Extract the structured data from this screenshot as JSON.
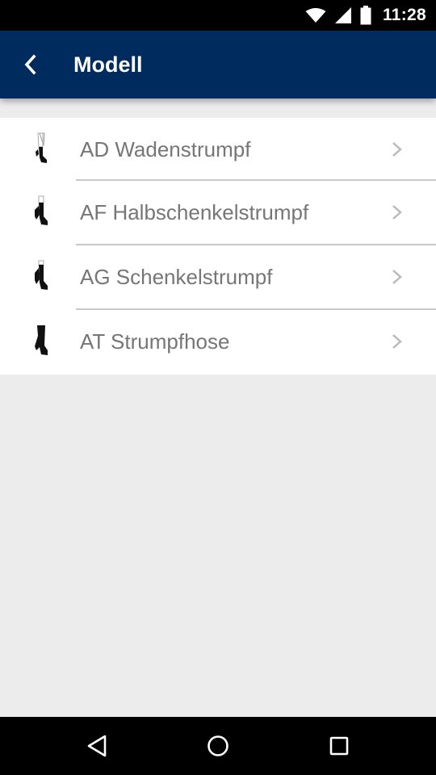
{
  "status_bar": {
    "time": "11:28",
    "icons": [
      "wifi-icon",
      "signal-icon",
      "battery-icon"
    ]
  },
  "app_bar": {
    "title": "Modell",
    "back_icon": "chevron-left-icon",
    "background_color": "#002b5f"
  },
  "list": {
    "items": [
      {
        "label": "AD Wadenstrumpf",
        "icon": "stocking-calf-icon"
      },
      {
        "label": "AF Halbschenkelstrumpf",
        "icon": "stocking-half-thigh-icon"
      },
      {
        "label": "AG Schenkelstrumpf",
        "icon": "stocking-thigh-icon"
      },
      {
        "label": "AT Strumpfhose",
        "icon": "pantyhose-icon"
      }
    ],
    "label_color": "#767676",
    "chevron_icon": "chevron-right-icon"
  },
  "nav_bar": {
    "buttons": [
      "back-triangle-icon",
      "home-circle-icon",
      "recents-square-icon"
    ]
  }
}
